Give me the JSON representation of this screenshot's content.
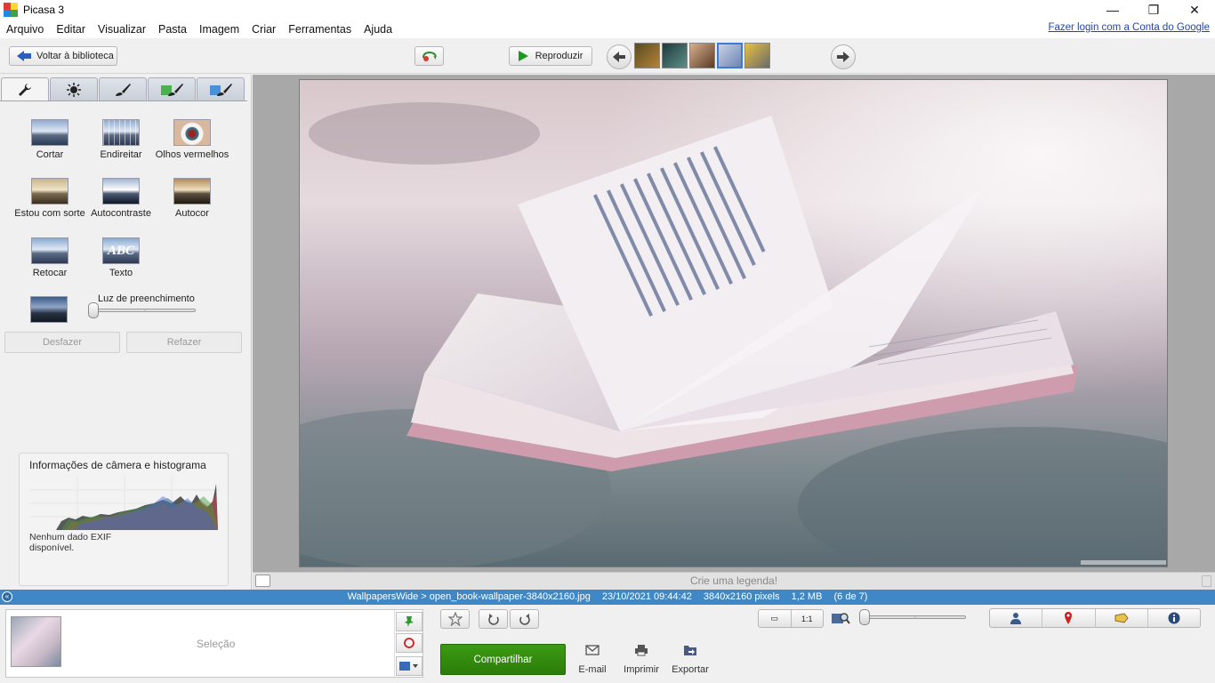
{
  "window": {
    "title": "Picasa 3",
    "minimize": "—",
    "maximize": "❐",
    "close": "✕"
  },
  "menu": [
    "Arquivo",
    "Editar",
    "Visualizar",
    "Pasta",
    "Imagem",
    "Criar",
    "Ferramentas",
    "Ajuda"
  ],
  "login_link": "Fazer login com a Conta do Google",
  "toolbar": {
    "back_label": "Voltar à biblioteca",
    "play_label": "Reproduzir",
    "prev_glyph": "🡄",
    "next_glyph": "🡆",
    "view_single": "A",
    "view_compare": [
      "A",
      "B"
    ],
    "view_compare_same": [
      "A",
      "A"
    ]
  },
  "thumbnails": [
    {
      "name": "thumb-1",
      "colors": [
        "#5a4a22",
        "#b3843a"
      ],
      "selected": false
    },
    {
      "name": "thumb-2",
      "colors": [
        "#1d3a3a",
        "#5e8f8a"
      ],
      "selected": false
    },
    {
      "name": "thumb-3",
      "colors": [
        "#d8b08a",
        "#5a3a28"
      ],
      "selected": false
    },
    {
      "name": "thumb-4",
      "colors": [
        "#c8d2e6",
        "#6e84b2"
      ],
      "selected": true
    },
    {
      "name": "thumb-5",
      "colors": [
        "#e8c040",
        "#6a6a6a"
      ],
      "selected": false
    }
  ],
  "tools": [
    {
      "label": "Cortar"
    },
    {
      "label": "Endireitar"
    },
    {
      "label": "Olhos vermelhos"
    },
    {
      "label": "Estou com sorte"
    },
    {
      "label": "Autocontraste"
    },
    {
      "label": "Autocor"
    },
    {
      "label": "Retocar"
    },
    {
      "label": "Texto",
      "icon_text": "ABC"
    }
  ],
  "fill_light": {
    "label": "Luz de preenchimento",
    "value": 0
  },
  "undo_label": "Desfazer",
  "redo_label": "Refazer",
  "histogram": {
    "title": "Informações de câmera e histograma",
    "exif": "Nenhum dado EXIF disponível."
  },
  "caption_placeholder": "Crie uma legenda!",
  "status": {
    "path": "WallpapersWide > open_book-wallpaper-3840x2160.jpg",
    "datetime": "23/10/2021 09:44:42",
    "dimensions": "3840x2160 pixels",
    "size": "1,2 MB",
    "position": "(6 de 7)"
  },
  "tray": {
    "label": "Seleção"
  },
  "share_label": "Compartilhar",
  "actions": [
    {
      "label": "E-mail"
    },
    {
      "label": "Imprimir"
    },
    {
      "label": "Exportar"
    }
  ],
  "zoom": {
    "fit": "▭",
    "actual": "1:1",
    "value": 0
  },
  "colors": {
    "accent": "#3f88c5",
    "share_green": "#2f850c"
  }
}
